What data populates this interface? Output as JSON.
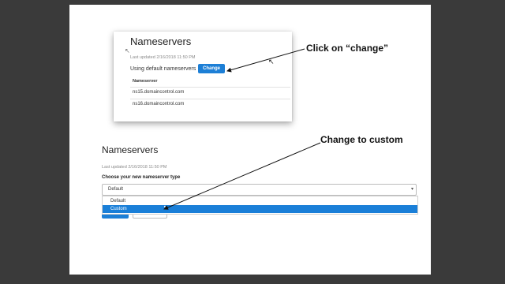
{
  "card": {
    "title": "Nameservers",
    "last_updated": "Last updated 2/16/2018 11:50 PM",
    "using_text": "Using default nameservers",
    "change_label": "Change",
    "column_header": "Nameserver",
    "rows": [
      "ns15.domaincontrol.com",
      "ns16.domaincontrol.com"
    ]
  },
  "callouts": {
    "click_change": "Click on “change”",
    "change_custom": "Change to custom"
  },
  "form": {
    "title": "Nameservers",
    "last_updated": "Last updated 2/16/2018 11:50 PM",
    "choose_label": "Choose your new nameserver type",
    "selected": "Default",
    "options": [
      "Default",
      "Custom"
    ]
  },
  "colors": {
    "accent": "#1d7fd6",
    "highlight": "#1a7fd8"
  }
}
